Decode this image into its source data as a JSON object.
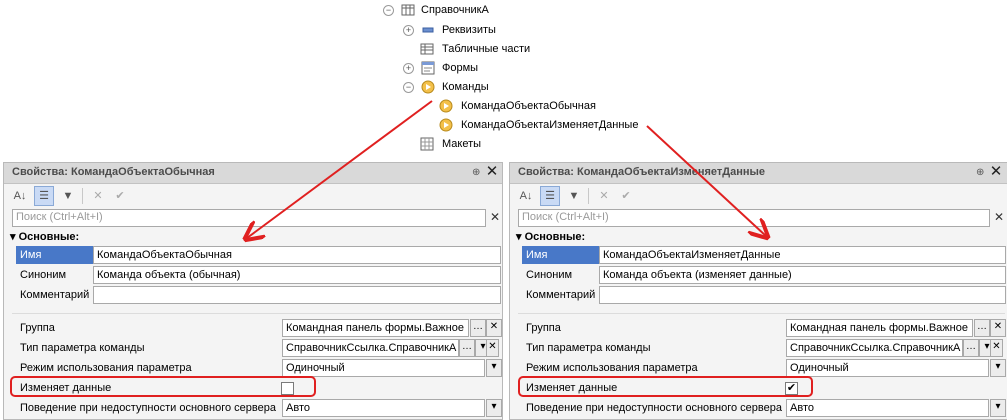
{
  "tree": {
    "catalog": "СправочникА",
    "attributes": "Реквизиты",
    "tabular": "Табличные части",
    "forms": "Формы",
    "commands": "Команды",
    "cmd_normal": "КомандаОбъектаОбычная",
    "cmd_changes": "КомандаОбъектаИзменяетДанные",
    "layouts": "Макеты"
  },
  "left": {
    "title": "Свойства: КомандаОбъектаОбычная",
    "search_placeholder": "Поиск (Ctrl+Alt+I)",
    "section": "Основные:",
    "labels": {
      "name": "Имя",
      "synonym": "Синоним",
      "comment": "Комментарий",
      "group": "Группа",
      "param_type": "Тип параметра команды",
      "param_mode": "Режим использования параметра",
      "modifies": "Изменяет данные",
      "behavior": "Поведение при недоступности основного сервера"
    },
    "values": {
      "name": "КомандаОбъектаОбычная",
      "synonym": "Команда объекта (обычная)",
      "comment": "",
      "group": "Командная панель формы.Важное",
      "param_type": "СправочникСсылка.СправочникА",
      "param_mode": "Одиночный",
      "modifies_checked": false,
      "behavior": "Авто"
    }
  },
  "right": {
    "title": "Свойства: КомандаОбъектаИзменяетДанные",
    "search_placeholder": "Поиск (Ctrl+Alt+I)",
    "section": "Основные:",
    "labels": {
      "name": "Имя",
      "synonym": "Синоним",
      "comment": "Комментарий",
      "group": "Группа",
      "param_type": "Тип параметра команды",
      "param_mode": "Режим использования параметра",
      "modifies": "Изменяет данные",
      "behavior": "Поведение при недоступности основного сервера"
    },
    "values": {
      "name": "КомандаОбъектаИзменяетДанные",
      "synonym": "Команда объекта (изменяет данные)",
      "comment": "",
      "group": "Командная панель формы.Важное",
      "param_type": "СправочникСсылка.СправочникА",
      "param_mode": "Одиночный",
      "modifies_checked": true,
      "behavior": "Авто"
    }
  },
  "icons": {
    "expand": "plus-circle",
    "collapse": "minus-circle",
    "close": "close-x",
    "pin": "pin",
    "check": "checkmark",
    "ellipsis": "...",
    "dropdown": "▼"
  },
  "colors": {
    "annotation": "#e02020",
    "selection": "#4878c8",
    "title_bar": "#d9d9d9"
  }
}
